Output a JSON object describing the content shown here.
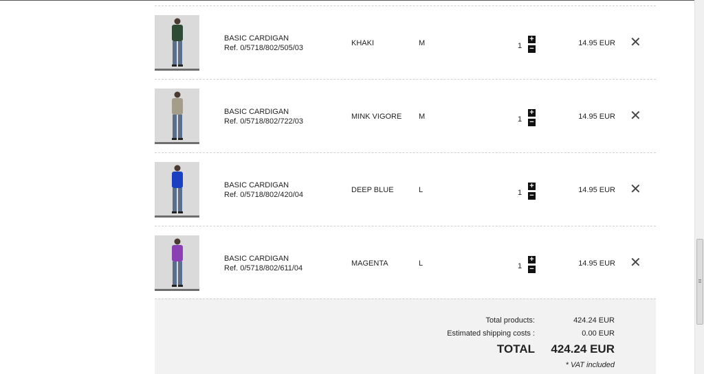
{
  "cart": {
    "items": [
      {
        "name": "BASIC CARDIGAN",
        "ref": "Ref. 0/5718/802/505/03",
        "color": "KHAKI",
        "size": "M",
        "qty": "1",
        "price": "14.95 EUR",
        "swatch": "#2f4a35"
      },
      {
        "name": "BASIC CARDIGAN",
        "ref": "Ref. 0/5718/802/722/03",
        "color": "MINK VIGORE",
        "size": "M",
        "qty": "1",
        "price": "14.95 EUR",
        "swatch": "#a39d8a"
      },
      {
        "name": "BASIC CARDIGAN",
        "ref": "Ref. 0/5718/802/420/04",
        "color": "DEEP BLUE",
        "size": "L",
        "qty": "1",
        "price": "14.95 EUR",
        "swatch": "#1a3fc0"
      },
      {
        "name": "BASIC CARDIGAN",
        "ref": "Ref. 0/5718/802/611/04",
        "color": "MAGENTA",
        "size": "L",
        "qty": "1",
        "price": "14.95 EUR",
        "swatch": "#8a3fb3"
      }
    ],
    "plus_glyph": "+",
    "minus_glyph": "−",
    "remove_glyph": "✕"
  },
  "summary": {
    "total_products_label": "Total products:",
    "total_products_value": "424.24 EUR",
    "shipping_label": "Estimated shipping costs :",
    "shipping_value": "0.00 EUR",
    "total_label": "TOTAL",
    "total_value": "424.24 EUR",
    "vat_note": "* VAT included"
  },
  "icons": {
    "plus": "plus-icon",
    "minus": "minus-icon",
    "remove": "close-icon"
  }
}
